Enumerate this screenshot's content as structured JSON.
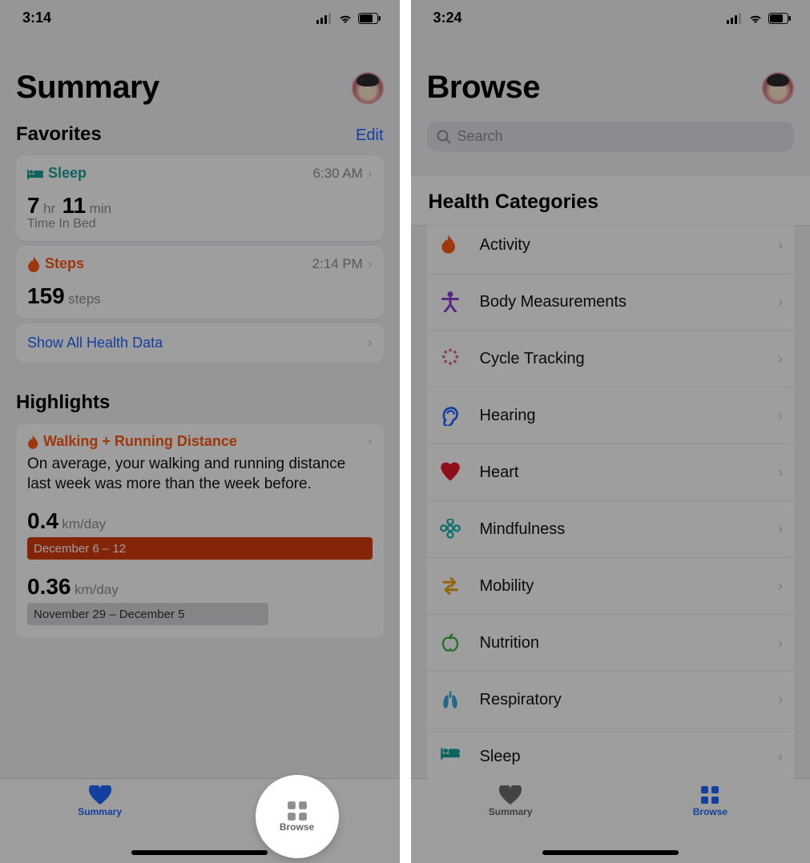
{
  "left": {
    "status": {
      "time": "3:14"
    },
    "title": "Summary",
    "favorites": {
      "header": "Favorites",
      "edit": "Edit",
      "sleep": {
        "label": "Sleep",
        "time": "6:30 AM",
        "value_h": "7",
        "unit_h": "hr",
        "value_m": "11",
        "unit_m": "min",
        "sublabel": "Time In Bed"
      },
      "steps": {
        "label": "Steps",
        "time": "2:14 PM",
        "value": "159",
        "unit": "steps"
      },
      "show_all": "Show All Health Data"
    },
    "highlights": {
      "header": "Highlights",
      "title": "Walking + Running Distance",
      "body": "On average, your walking and running distance last week was more than the week before.",
      "v1": "0.4",
      "u1": "km/day",
      "range1": "December 6 – 12",
      "v2": "0.36",
      "u2": "km/day",
      "range2": "November 29 – December 5"
    },
    "tabs": {
      "summary": "Summary",
      "browse": "Browse"
    }
  },
  "right": {
    "status": {
      "time": "3:24"
    },
    "title": "Browse",
    "search_placeholder": "Search",
    "categories_header": "Health Categories",
    "categories": [
      {
        "label": "Activity",
        "icon": "flame",
        "color": "#ff5a12"
      },
      {
        "label": "Body Measurements",
        "icon": "figure",
        "color": "#8f3fd6"
      },
      {
        "label": "Cycle Tracking",
        "icon": "cycle",
        "color": "#e36a7a"
      },
      {
        "label": "Hearing",
        "icon": "ear",
        "color": "#1f66ff"
      },
      {
        "label": "Heart",
        "icon": "heart",
        "color": "#e9162a"
      },
      {
        "label": "Mindfulness",
        "icon": "flower",
        "color": "#17b9b0"
      },
      {
        "label": "Mobility",
        "icon": "arrows",
        "color": "#f2a217"
      },
      {
        "label": "Nutrition",
        "icon": "apple",
        "color": "#3fb24a"
      },
      {
        "label": "Respiratory",
        "icon": "lungs",
        "color": "#3aa9e0"
      },
      {
        "label": "Sleep",
        "icon": "bed",
        "color": "#18a39a"
      }
    ],
    "tabs": {
      "summary": "Summary",
      "browse": "Browse"
    }
  }
}
